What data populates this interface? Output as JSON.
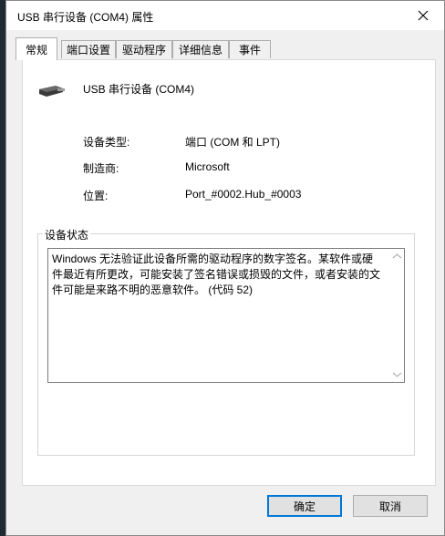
{
  "window": {
    "title": "USB 串行设备 (COM4) 属性"
  },
  "tabs": [
    {
      "label": "常规"
    },
    {
      "label": "端口设置"
    },
    {
      "label": "驱动程序"
    },
    {
      "label": "详细信息"
    },
    {
      "label": "事件"
    }
  ],
  "device": {
    "name": "USB 串行设备 (COM4)"
  },
  "properties": [
    {
      "label": "设备类型:",
      "value": "端口 (COM 和 LPT)"
    },
    {
      "label": "制造商:",
      "value": "Microsoft"
    },
    {
      "label": "位置:",
      "value": "Port_#0002.Hub_#0003"
    }
  ],
  "status": {
    "legend": "设备状态",
    "text": "Windows 无法验证此设备所需的驱动程序的数字签名。某软件或硬件最近有所更改，可能安装了签名错误或损毁的文件，或者安装的文件可能是来路不明的恶意软件。 (代码 52)"
  },
  "buttons": {
    "ok": "确定",
    "cancel": "取消"
  }
}
